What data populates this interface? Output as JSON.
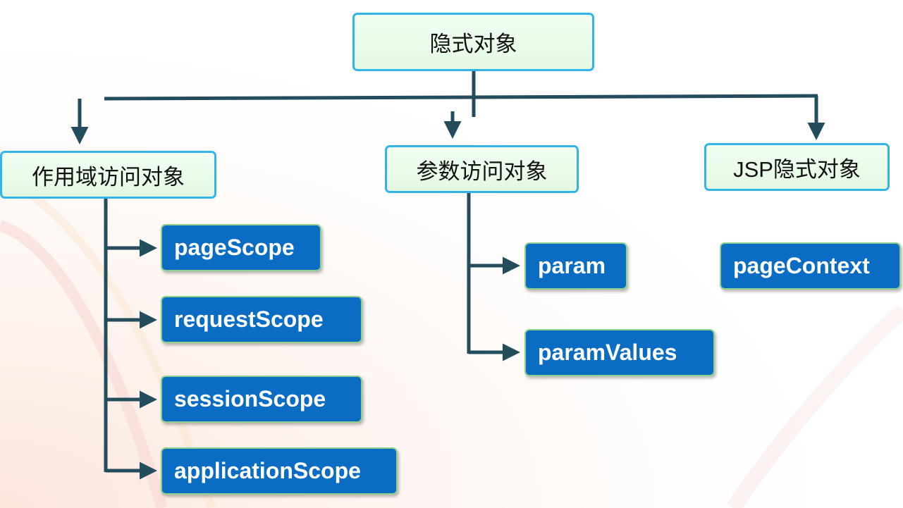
{
  "diagram": {
    "root": {
      "label": "隐式对象"
    },
    "categories": [
      {
        "label": "作用域访问对象",
        "items": [
          "pageScope",
          "requestScope",
          "sessionScope",
          "applicationScope"
        ]
      },
      {
        "label": "参数访问对象",
        "items": [
          "param",
          "paramValues"
        ]
      },
      {
        "label": "JSP隐式对象",
        "items": [
          "pageContext"
        ]
      }
    ]
  },
  "colors": {
    "connector": "#234d5c",
    "leaf_fill": "#0a6cc2",
    "category_border": "#33b4e6",
    "category_fill": "#e9fbe9"
  }
}
